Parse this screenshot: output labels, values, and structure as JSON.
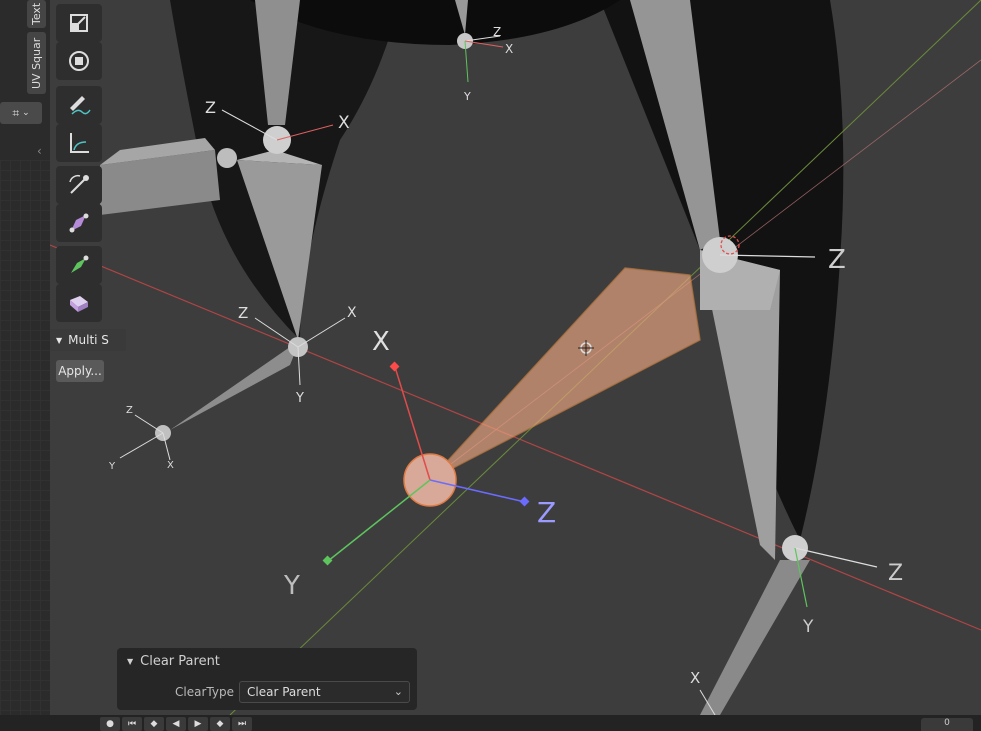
{
  "side_tabs": {
    "text": "Text",
    "uv": "UV Squar"
  },
  "toolbar": {
    "tools": [
      "scale-icon",
      "transform-icon",
      "annotate-icon",
      "measure-icon",
      "bone-roll-icon",
      "bone-size-icon",
      "envelope-icon",
      "box-icon"
    ]
  },
  "multi_panel": {
    "title": "Multi S",
    "apply_label": "Apply..."
  },
  "operator_panel": {
    "title": "Clear Parent",
    "field_label": "ClearType",
    "field_value": "Clear Parent"
  },
  "axis_labels": {
    "x": "X",
    "y": "Y",
    "z": "Z"
  },
  "timeline": {
    "frame": "0"
  },
  "colors": {
    "selected_bone": "#e8a07a",
    "x_axis": "#e04b4b",
    "y_axis": "#5ec45e",
    "z_axis": "#6b6bff",
    "background": "#3d3d3d"
  }
}
